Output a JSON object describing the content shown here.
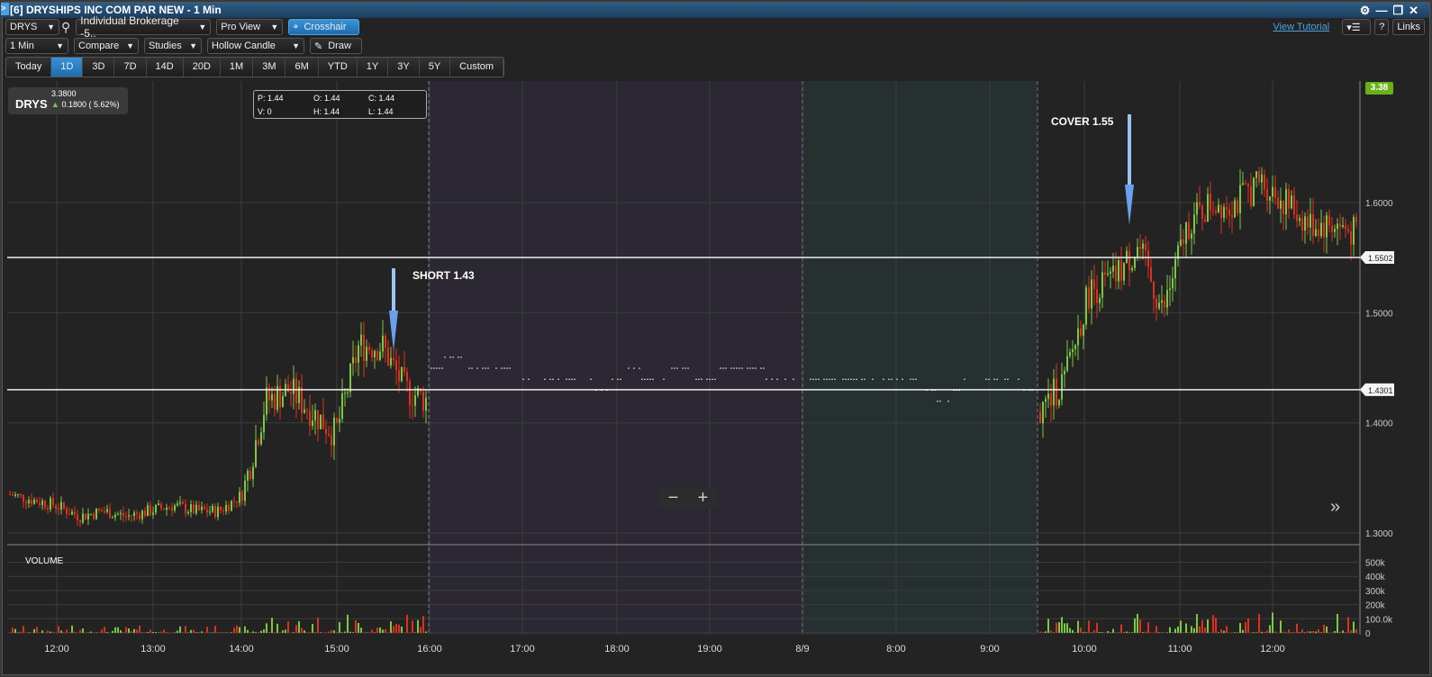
{
  "window": {
    "title": "[6] DRYSHIPS INC COM PAR NEW - 1 Min",
    "tag": ">",
    "controls": [
      "gear-icon",
      "minimize-icon",
      "restore-icon",
      "close-icon"
    ]
  },
  "toolbar1": {
    "symbol": "DRYS",
    "account": "Individual Brokerage -5..",
    "view": "Pro View",
    "crosshair": "Crosshair"
  },
  "toolbar2": {
    "interval": "1 Min",
    "compare": "Compare",
    "studies": "Studies",
    "chart_type": "Hollow Candle",
    "draw": "Draw"
  },
  "right_tools": {
    "tutorial": "View Tutorial",
    "help": "?",
    "links": "Links"
  },
  "ranges": [
    "Today",
    "1D",
    "3D",
    "7D",
    "14D",
    "20D",
    "1M",
    "3M",
    "6M",
    "YTD",
    "1Y",
    "3Y",
    "5Y",
    "Custom"
  ],
  "active_range": "1D",
  "quote": {
    "symbol": "DRYS",
    "last": "3.3800",
    "change": "0.1800 ( 5.62%)"
  },
  "ohlc": {
    "p": "P: 1.44",
    "o": "O: 1.44",
    "c": "C: 1.44",
    "v": "V: 0",
    "h": "H: 1.44",
    "l": "L: 1.44"
  },
  "annotations": {
    "short": "SHORT 1.43",
    "cover": "COVER 1.55"
  },
  "price_tag": "3.38",
  "hlines": [
    {
      "price": 1.5502,
      "label": "1.5502"
    },
    {
      "price": 1.4301,
      "label": "1.4301"
    }
  ],
  "volume_label": "VOLUME",
  "zoom": {
    "minus": "−",
    "plus": "+"
  },
  "expand": "»",
  "colors": {
    "up": "#7ac943",
    "down": "#e0301e",
    "accent": "#2a82c8",
    "tag": "#6ab018"
  },
  "chart_data": {
    "type": "candlestick",
    "y_ticks": [
      "1.3000",
      "1.4000",
      "1.5000",
      "1.6000"
    ],
    "y_tick_values": [
      1.3,
      1.4,
      1.5,
      1.6
    ],
    "volume_ticks": [
      "500k",
      "400k",
      "300k",
      "200k",
      "100.0k",
      "0"
    ],
    "x_ticks": [
      "12:00",
      "13:00",
      "14:00",
      "15:00",
      "16:00",
      "17:00",
      "18:00",
      "19:00",
      "8/9",
      "8:00",
      "9:00",
      "10:00",
      "11:00",
      "12:00"
    ],
    "segments": [
      {
        "session": "regular",
        "closes": [
          1.335,
          1.33,
          1.325,
          1.315,
          1.32,
          1.315,
          1.32,
          1.325,
          1.32,
          1.32,
          1.335,
          1.42,
          1.43,
          1.41,
          1.39,
          1.47,
          1.47,
          1.43,
          1.42
        ]
      },
      {
        "session": "after-hours",
        "closes": [
          1.45,
          1.46,
          1.45,
          1.45,
          1.44,
          1.44,
          1.44,
          1.43,
          1.45,
          1.44,
          1.45,
          1.44,
          1.45,
          1.45,
          1.44,
          1.44
        ]
      },
      {
        "session": "pre-market",
        "closes": [
          1.44,
          1.44,
          1.44,
          1.44,
          1.44,
          1.44,
          1.42,
          1.44,
          1.44,
          1.44,
          1.43
        ]
      },
      {
        "session": "regular",
        "closes": [
          1.41,
          1.44,
          1.52,
          1.53,
          1.56,
          1.5,
          1.58,
          1.6,
          1.6,
          1.62,
          1.6,
          1.58,
          1.58,
          1.57
        ]
      }
    ]
  }
}
